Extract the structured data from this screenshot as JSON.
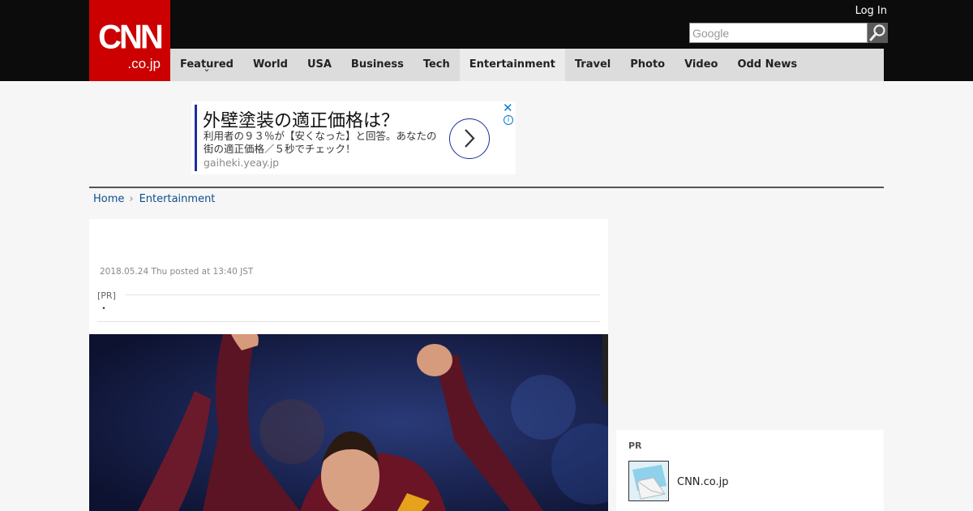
{
  "header": {
    "logo_main": "CNN",
    "logo_sub": ".co.jp",
    "login_label": "Log In",
    "search_placeholder": "Google",
    "search_button_icon": "magnifier-icon"
  },
  "nav": {
    "items": [
      {
        "label": "Featured"
      },
      {
        "label": "World"
      },
      {
        "label": "USA"
      },
      {
        "label": "Business"
      },
      {
        "label": "Tech"
      },
      {
        "label": "Entertainment"
      },
      {
        "label": "Travel"
      },
      {
        "label": "Photo"
      },
      {
        "label": "Video"
      },
      {
        "label": "Odd News"
      }
    ],
    "active": "Entertainment",
    "featured_chevron": "⌄"
  },
  "ad": {
    "title": "外壁塗装の適正価格は？",
    "body": "利用者の９３％が【安くなった】と回答。あなたの街の適正価格／５秒でチェック！",
    "url": "gaiheki.yeay.jp",
    "close": "✕",
    "info": "i"
  },
  "breadcrumb": {
    "home": "Home",
    "separator": "›",
    "current": "Entertainment"
  },
  "article": {
    "date": "2018.05.24 Thu posted at 13:40 JST",
    "pr_label": "[PR]",
    "pr_text": "・"
  },
  "sidebar": {
    "pr_label": "PR",
    "sponsor_name": "CNN.co.jp"
  },
  "colors": {
    "brand_red": "#cc0000",
    "topbar": "#0c0c0c",
    "nav_bg": "#dcdcdc",
    "link": "#0e4f8a",
    "ad_accent": "#1c2e9c"
  }
}
